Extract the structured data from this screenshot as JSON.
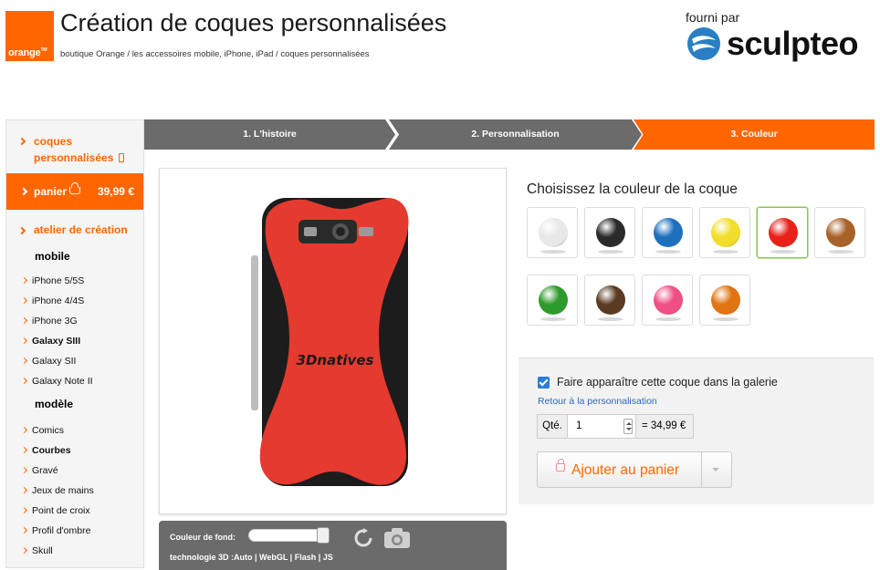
{
  "header": {
    "logo_text": "orange",
    "title": "Création de coques personnalisées",
    "breadcrumb": "boutique Orange / les accessoires mobile, iPhone, iPad / coques personnalisées",
    "provided_by": "fourni par",
    "partner_brand": "sculpteo"
  },
  "sidebar": {
    "top_link": "coques personnalisées",
    "cart": {
      "label": "panier",
      "price": "39,99 €"
    },
    "atelier": "atelier de création",
    "groups": [
      {
        "title": "mobile",
        "items": [
          {
            "label": "iPhone 5/5S",
            "bold": false
          },
          {
            "label": "iPhone 4/4S",
            "bold": false
          },
          {
            "label": "iPhone 3G",
            "bold": false
          },
          {
            "label": "Galaxy SIII",
            "bold": true
          },
          {
            "label": "Galaxy SII",
            "bold": false
          },
          {
            "label": "Galaxy Note II",
            "bold": false
          }
        ]
      },
      {
        "title": "modèle",
        "items": [
          {
            "label": "Comics",
            "bold": false
          },
          {
            "label": "Courbes",
            "bold": true
          },
          {
            "label": "Gravé",
            "bold": false
          },
          {
            "label": "Jeux de mains",
            "bold": false
          },
          {
            "label": "Point de croix",
            "bold": false
          },
          {
            "label": "Profil d'ombre",
            "bold": false
          },
          {
            "label": "Skull",
            "bold": false
          }
        ]
      }
    ]
  },
  "steps": [
    {
      "label": "1. L'histoire",
      "active": false
    },
    {
      "label": "2. Personnalisation",
      "active": false
    },
    {
      "label": "3. Couleur",
      "active": true
    }
  ],
  "preview": {
    "case_text": "3Dnatives",
    "background_label": "Couleur de fond:",
    "tech_line": "technologie 3D :Auto | WebGL | Flash | JS"
  },
  "colors": {
    "title": "Choisissez la couleur de la coque",
    "swatches": [
      {
        "name": "white",
        "hex": "#e8e8e8",
        "selected": false
      },
      {
        "name": "black",
        "hex": "#2a2a2a",
        "selected": false
      },
      {
        "name": "blue",
        "hex": "#1f6fbf",
        "selected": false
      },
      {
        "name": "yellow",
        "hex": "#f2de2a",
        "selected": false
      },
      {
        "name": "red",
        "hex": "#e8211a",
        "selected": true
      },
      {
        "name": "bronze",
        "hex": "#a7622a",
        "selected": false
      },
      {
        "name": "green",
        "hex": "#2e9a2a",
        "selected": false
      },
      {
        "name": "brown",
        "hex": "#5a3a22",
        "selected": false
      },
      {
        "name": "pink",
        "hex": "#ef4f85",
        "selected": false
      },
      {
        "name": "orange",
        "hex": "#e17412",
        "selected": false
      }
    ]
  },
  "order": {
    "gallery_checked": true,
    "gallery_label": "Faire apparaître cette coque dans la galerie",
    "back_link": "Retour à la personnalisation",
    "qty_label": "Qté.",
    "qty_value": "1",
    "total": "= 34,99 €",
    "add_to_cart": "Ajouter au panier"
  },
  "theme": {
    "accent": "#ff6600",
    "step_gray": "#6b6b6b",
    "link": "#2a6bbf"
  }
}
